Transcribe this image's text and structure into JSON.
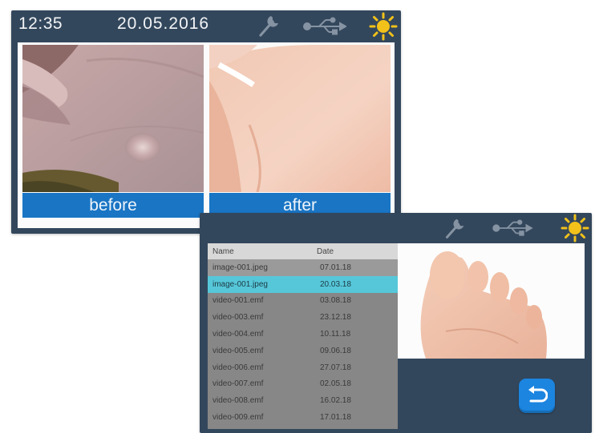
{
  "screen1": {
    "time": "12:35",
    "date": "20.05.2016",
    "icons": [
      "wrench-icon",
      "usb-icon",
      "sun-icon"
    ],
    "images": [
      {
        "label": "before"
      },
      {
        "label": "after"
      }
    ]
  },
  "screen2": {
    "icons": [
      "wrench-icon",
      "usb-icon",
      "sun-icon"
    ],
    "file_list": {
      "columns": [
        "Name",
        "Date"
      ],
      "rows": [
        {
          "name": "image-001.jpeg",
          "date": "07.01.18"
        },
        {
          "name": "image-001.jpeg",
          "date": "20.03.18",
          "selected": true
        },
        {
          "name": "video-001.emf",
          "date": "03.08.18"
        },
        {
          "name": "video-003.emf",
          "date": "23.12.18"
        },
        {
          "name": "video-004.emf",
          "date": "10.11.18"
        },
        {
          "name": "video-005.emf",
          "date": "09.06.18"
        },
        {
          "name": "video-006.emf",
          "date": "27.07.18"
        },
        {
          "name": "video-007.emf",
          "date": "02.05.18"
        },
        {
          "name": "video-008.emf",
          "date": "16.02.18"
        },
        {
          "name": "video-009.emf",
          "date": "17.01.18"
        }
      ]
    },
    "back_icon": "back-arrow-icon"
  },
  "colors": {
    "panel": "#33475c",
    "accent": "#1a75c4",
    "selected_row": "#56c7d9",
    "sun": "#f2c21a"
  }
}
